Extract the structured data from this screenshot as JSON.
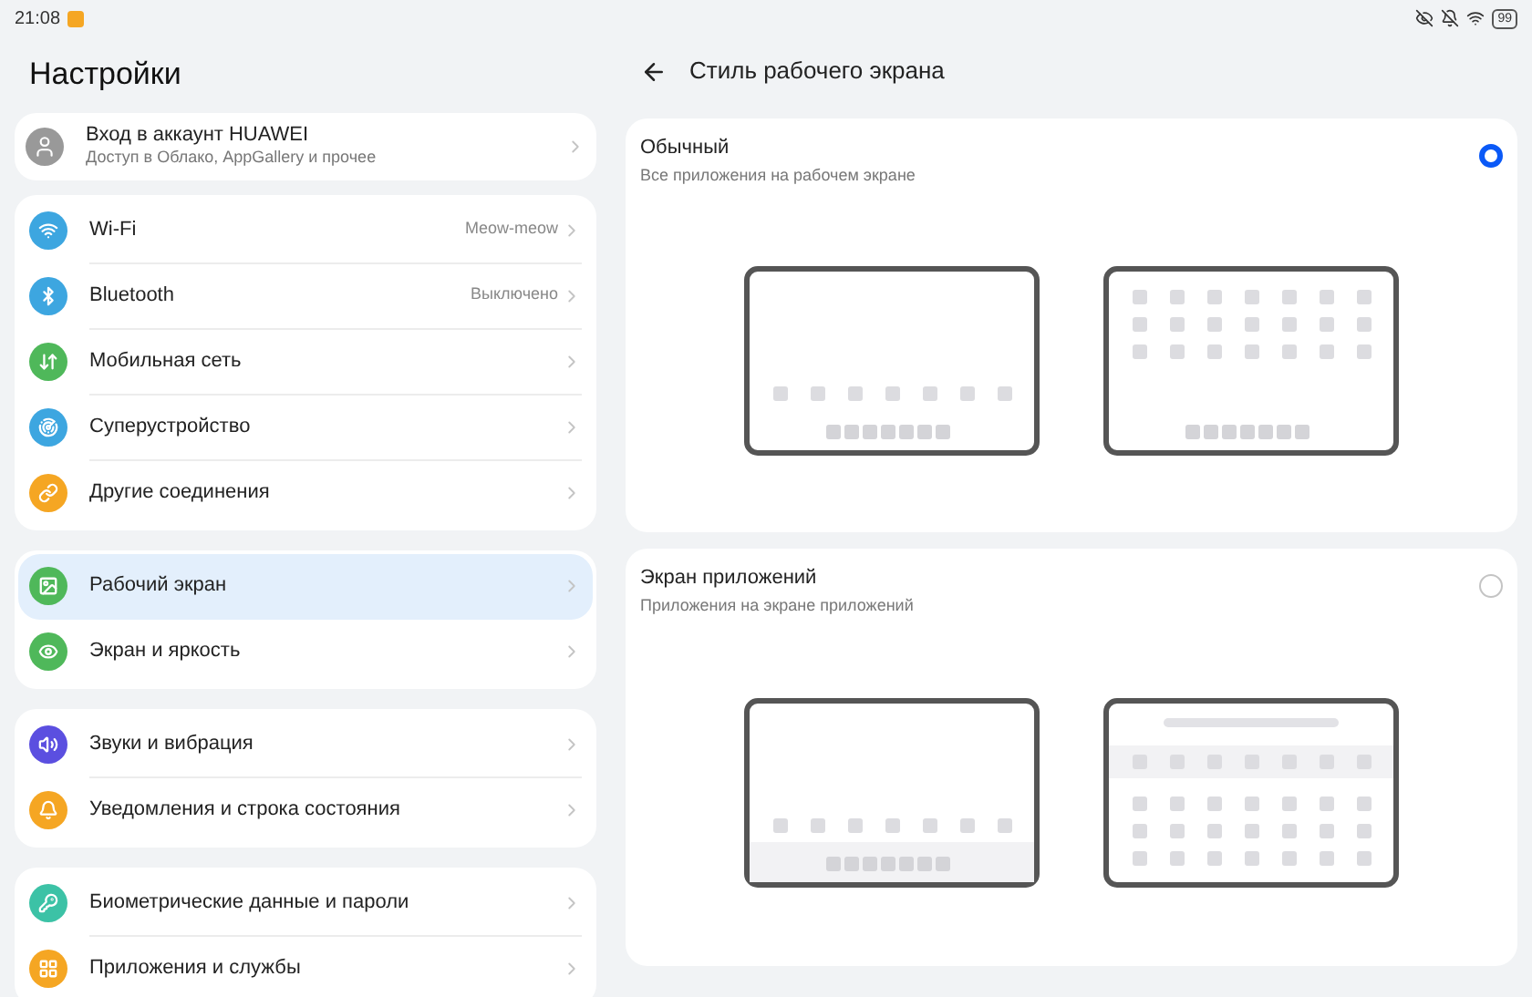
{
  "status_bar": {
    "time": "21:08",
    "battery": "99"
  },
  "sidebar": {
    "title": "Настройки",
    "account": {
      "title": "Вход в аккаунт HUAWEI",
      "subtitle": "Доступ в Облако, AppGallery и прочее"
    },
    "groups": [
      {
        "items": [
          {
            "label": "Wi-Fi",
            "value": "Meow-meow",
            "color": "#3da6e0",
            "selected": false
          },
          {
            "label": "Bluetooth",
            "value": "Выключено",
            "color": "#3da6e0",
            "selected": false
          },
          {
            "label": "Мобильная сеть",
            "color": "#4fb85a",
            "selected": false
          },
          {
            "label": "Суперустройство",
            "color": "#3da6e0",
            "selected": false
          },
          {
            "label": "Другие соединения",
            "color": "#f5a623",
            "selected": false
          }
        ]
      },
      {
        "items": [
          {
            "label": "Рабочий экран",
            "color": "#4fb85a",
            "selected": true
          },
          {
            "label": "Экран и яркость",
            "color": "#4fb85a",
            "selected": false
          }
        ]
      },
      {
        "items": [
          {
            "label": "Звуки и вибрация",
            "color": "#5b4fe0",
            "selected": false
          },
          {
            "label": "Уведомления и строка состояния",
            "color": "#f5a623",
            "selected": false
          }
        ]
      },
      {
        "items": [
          {
            "label": "Биометрические данные и пароли",
            "color": "#3cc2a6",
            "selected": false
          },
          {
            "label": "Приложения и службы",
            "color": "#f5a623",
            "selected": false
          }
        ]
      }
    ]
  },
  "detail": {
    "title": "Стиль рабочего экрана",
    "options": [
      {
        "title": "Обычный",
        "subtitle": "Все приложения на рабочем экране",
        "selected": true
      },
      {
        "title": "Экран приложений",
        "subtitle": "Приложения на экране приложений",
        "selected": false
      }
    ]
  }
}
